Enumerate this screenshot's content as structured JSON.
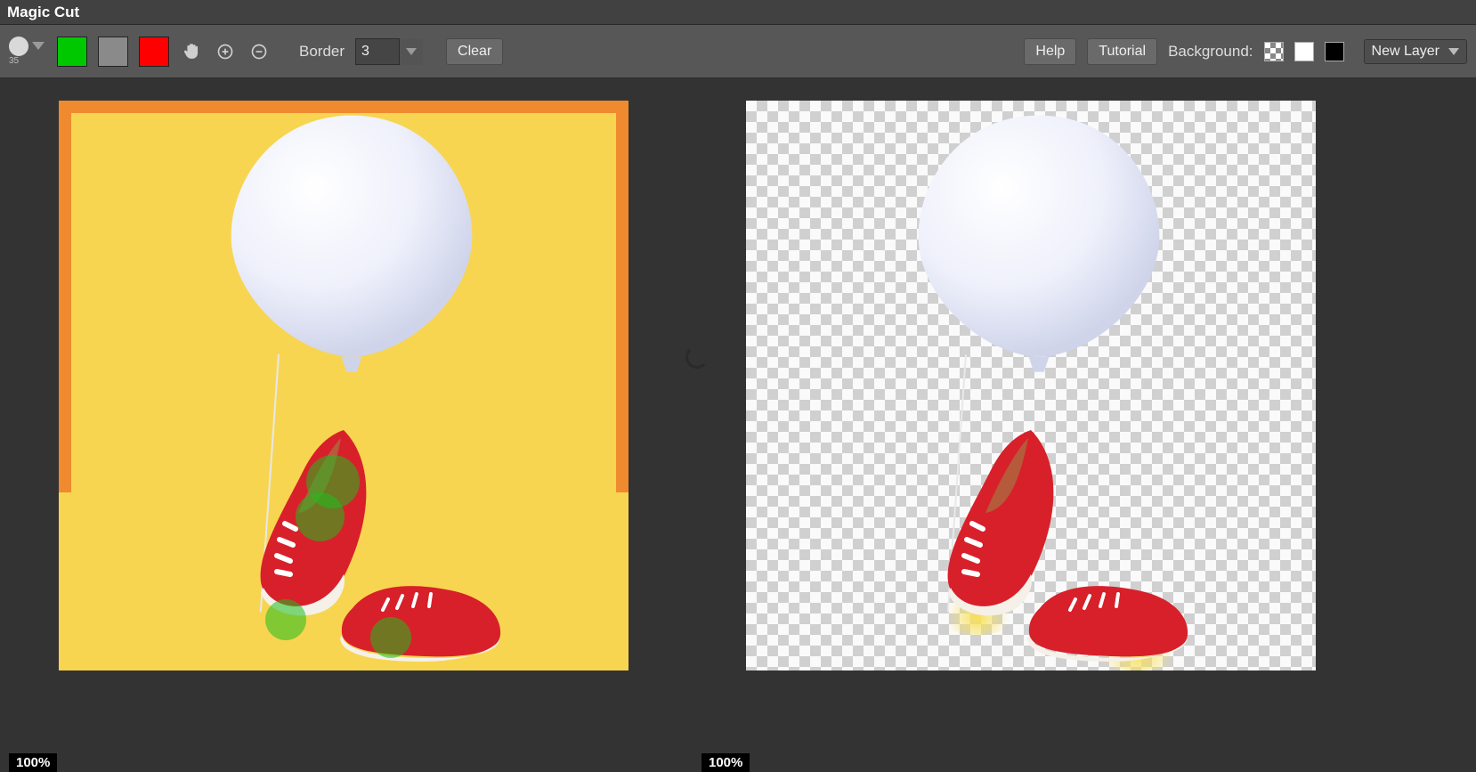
{
  "window": {
    "title": "Magic Cut"
  },
  "toolbar": {
    "brush_size": "35",
    "colors": {
      "green": "#00c800",
      "gray": "#8a8a8a",
      "red": "#ff0000"
    },
    "border_label": "Border",
    "border_value": "3",
    "clear_label": "Clear",
    "help_label": "Help",
    "tutorial_label": "Tutorial",
    "background_label": "Background:",
    "dropdown_label": "New Layer"
  },
  "workspace": {
    "zoom_left": "100%",
    "zoom_right": "100%"
  }
}
